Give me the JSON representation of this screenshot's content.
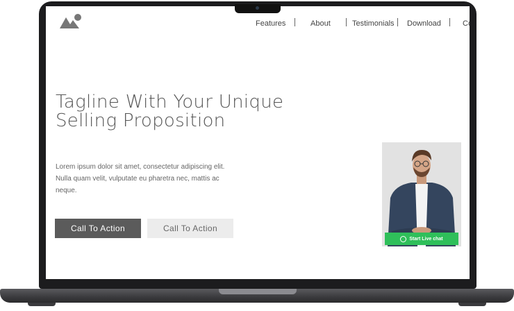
{
  "nav": {
    "items": [
      {
        "label": "Features"
      },
      {
        "label": "About"
      },
      {
        "label": "Testimonials"
      },
      {
        "label": "Download"
      },
      {
        "label": "Co"
      }
    ]
  },
  "hero": {
    "tagline_line1": "Tagline With Your Unique",
    "tagline_line2": "Selling Proposition",
    "body": "Lorem ipsum dolor sit amet, consectetur adipiscing elit. Nulla quam velit, vulputate eu pharetra nec, mattis ac neque.",
    "cta_primary": "Call To Action",
    "cta_secondary": "Call To Action"
  },
  "chat_widget": {
    "button_label": "Start Live chat",
    "icon": "chat-bubble-icon",
    "accent_color": "#2fbf5a"
  },
  "colors": {
    "primary_button": "#5b5b5b",
    "secondary_button": "#ececec",
    "text": "#555555"
  }
}
